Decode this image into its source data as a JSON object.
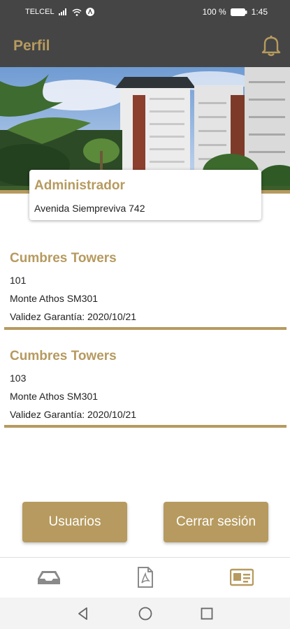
{
  "status_bar": {
    "carrier": "TELCEL",
    "battery_percent": "100 %",
    "time": "1:45"
  },
  "app_bar": {
    "title": "Perfil"
  },
  "admin": {
    "role": "Administrador",
    "address": "Avenida Siempreviva 742"
  },
  "units": [
    {
      "building": "Cumbres Towers",
      "number": "101",
      "model": "Monte Athos SM301",
      "warranty": "Validez Garantía: 2020/10/21"
    },
    {
      "building": "Cumbres Towers",
      "number": "103",
      "model": "Monte Athos SM301",
      "warranty": "Validez Garantía: 2020/10/21"
    }
  ],
  "actions": {
    "users_label": "Usuarios",
    "logout_label": "Cerrar sesión"
  },
  "bottom_nav": {
    "items": [
      {
        "icon": "inbox-icon",
        "active": false
      },
      {
        "icon": "pdf-document-icon",
        "active": false
      },
      {
        "icon": "id-card-icon",
        "active": true
      }
    ]
  },
  "colors": {
    "accent": "#b69a5f",
    "header": "#454545",
    "inactive_icon": "#8a8a8a"
  }
}
